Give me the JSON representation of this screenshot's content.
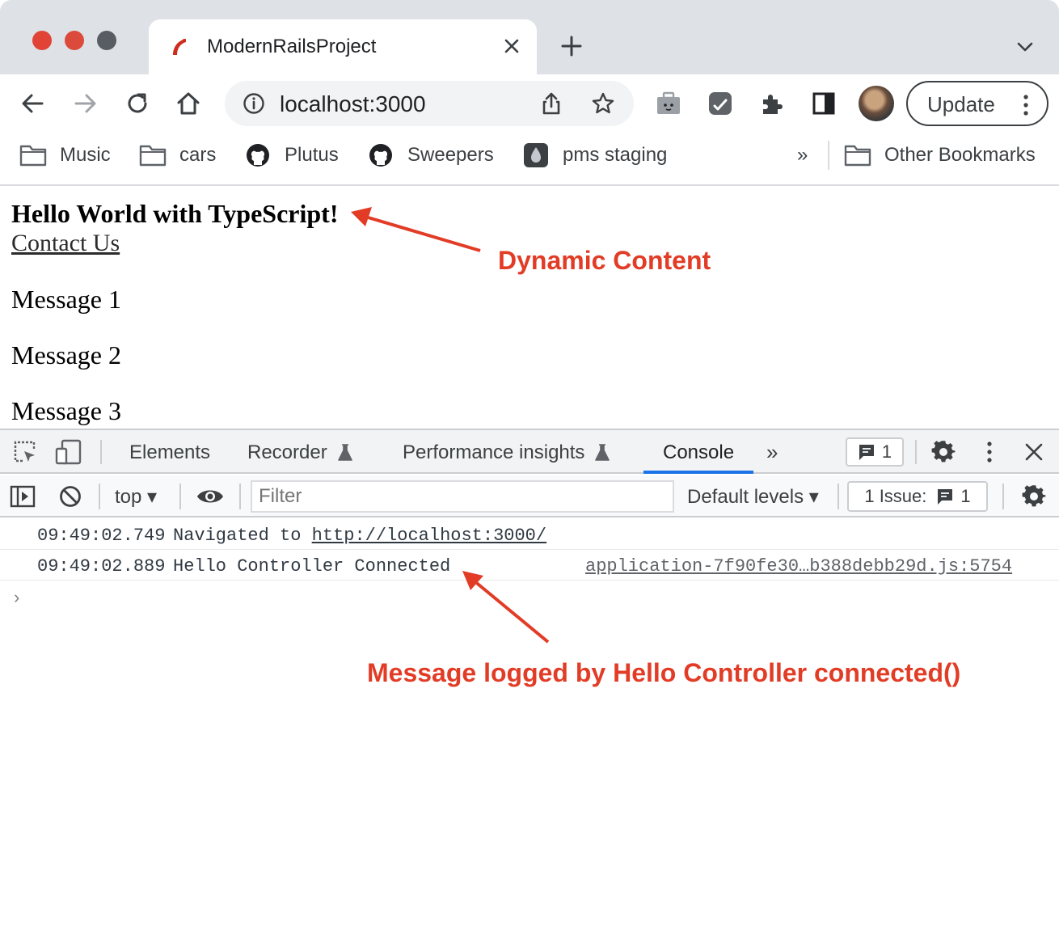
{
  "browser": {
    "tab_title": "ModernRailsProject",
    "url": "localhost:3000",
    "update_label": "Update"
  },
  "bookmarks": {
    "items": [
      "Music",
      "cars",
      "Plutus",
      "Sweepers",
      "pms staging"
    ],
    "overflow": "»",
    "other": "Other Bookmarks"
  },
  "page": {
    "heading": "Hello World with TypeScript!",
    "link": "Contact Us",
    "messages": [
      "Message 1",
      "Message 2",
      "Message 3"
    ]
  },
  "devtools": {
    "tabs": [
      "Elements",
      "Recorder",
      "Performance insights",
      "Console"
    ],
    "active_tab": "Console",
    "overflow": "»",
    "messages_badge": "1",
    "context": "top ▾",
    "filter_placeholder": "Filter",
    "levels": "Default levels ▾",
    "issues_label": "1 Issue:",
    "issues_count": "1",
    "prompt": "›",
    "logs": [
      {
        "time": "09:49:02.749",
        "text": "Navigated to",
        "link": "http://localhost:3000/",
        "source": ""
      },
      {
        "time": "09:49:02.889",
        "text": "Hello Controller Connected",
        "link": "",
        "source": "application-7f90fe30…b388debb29d.js:5754"
      }
    ]
  },
  "annotations": {
    "dynamic": "Dynamic Content",
    "message": "Message logged by Hello Controller connected()"
  },
  "colors": {
    "annotation": "#e23c26",
    "accent": "#1a73e8",
    "tabstrip": "#dee1e6"
  }
}
